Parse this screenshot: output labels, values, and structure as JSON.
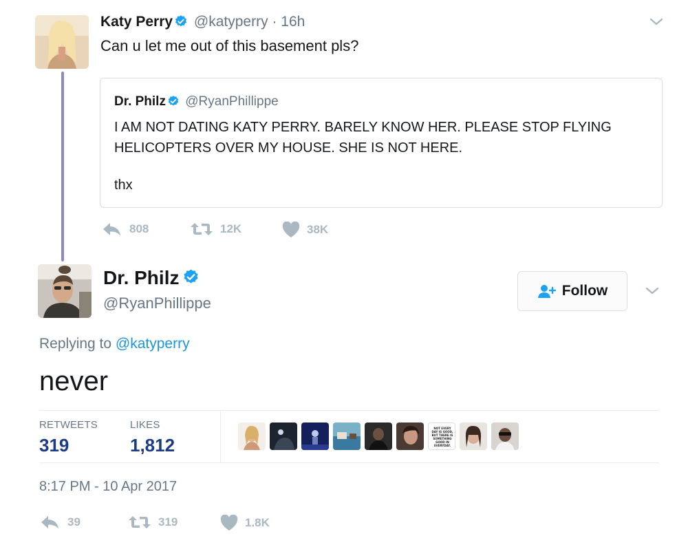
{
  "parent_tweet": {
    "name": "Katy Perry",
    "handle": "@katyperry",
    "separator": "·",
    "time": "16h",
    "text": "Can u let me out of this basement pls?",
    "quoted": {
      "name": "Dr. Philz",
      "handle": "@RyanPhillippe",
      "text": "I AM NOT DATING KATY PERRY. BARELY KNOW HER. PLEASE STOP FLYING HELICOPTERS OVER MY HOUSE. SHE IS NOT HERE.",
      "sign_off": "thx"
    },
    "actions": {
      "replies": "808",
      "retweets": "12K",
      "likes": "38K"
    }
  },
  "main_tweet": {
    "name": "Dr. Philz",
    "handle": "@RyanPhillippe",
    "follow_label": "Follow",
    "replying_prefix": "Replying to",
    "replying_to": "@katyperry",
    "text": "never",
    "stats": {
      "retweets_label": "RETWEETS",
      "retweets_value": "319",
      "likes_label": "LIKES",
      "likes_value": "1,812"
    },
    "liker_avatar_count": 9,
    "liker_note_lines": [
      "NOT EVERY",
      "DAY IS GOOD,",
      "BUT THERE IS",
      "SOMETHING",
      "GOOD IN",
      "EVERYDAY."
    ],
    "timestamp": "8:17 PM - 10 Apr 2017",
    "actions": {
      "replies": "39",
      "retweets": "319",
      "likes": "1.8K"
    }
  },
  "colors": {
    "verified": "#1da1f2",
    "thread_line": "#8c88c8",
    "stat_value": "#1c3b85",
    "action_gray": "#aab8c2",
    "mention": "#1b95e0"
  },
  "icons": [
    "verified-badge-icon",
    "chevron-down-icon",
    "reply-icon",
    "retweet-icon",
    "heart-icon",
    "follow-user-icon"
  ]
}
